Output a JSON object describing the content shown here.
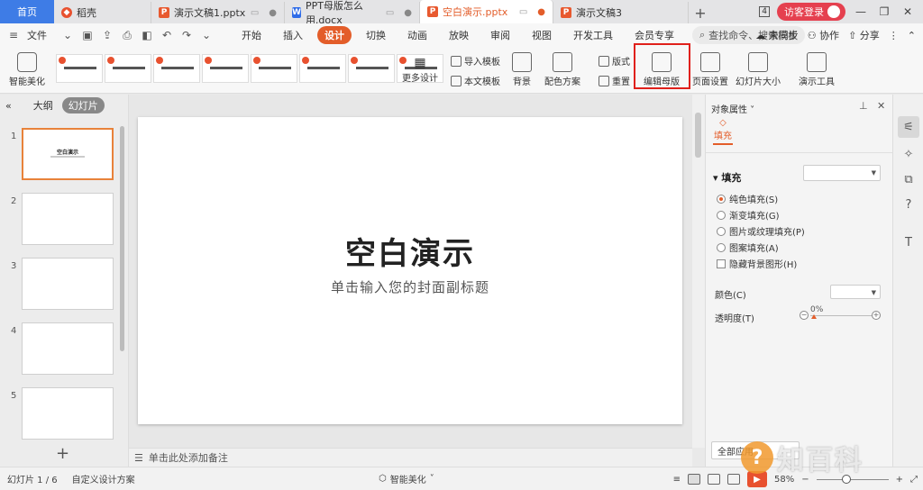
{
  "tabs": {
    "home": "首页",
    "items": [
      {
        "label": "稻壳",
        "icon": "daoke-icon"
      },
      {
        "label": "演示文稿1.pptx",
        "icon": "ppt-icon"
      },
      {
        "label": "PPT母版怎么用.docx",
        "icon": "word-icon"
      },
      {
        "label": "空白演示.pptx",
        "icon": "ppt-icon",
        "active": true
      },
      {
        "label": "演示文稿3",
        "icon": "ppt-icon"
      }
    ],
    "badge": "4",
    "visitor_login": "访客登录"
  },
  "menubar": {
    "file": "文件",
    "items": [
      "开始",
      "插入",
      "设计",
      "切换",
      "动画",
      "放映",
      "审阅",
      "视图",
      "开发工具",
      "会员专享"
    ],
    "active": "设计",
    "search": "查找命令、搜索模板",
    "sync": "未同步",
    "collab": "协作",
    "share": "分享"
  },
  "ribbon": {
    "smart_beautify": "智能美化",
    "more_design": "更多设计",
    "import_template": "导入模板",
    "text_template": "本文模板",
    "background": "背景",
    "color_scheme": "配色方案",
    "layout": "版式",
    "reset": "重置",
    "edit_master": "编辑母版",
    "page_setup": "页面设置",
    "slide_size": "幻灯片大小",
    "present_tools": "演示工具"
  },
  "left_panel": {
    "outline": "大纲",
    "slides": "幻灯片",
    "thumbs": [
      {
        "num": "1",
        "title": "空白演示"
      },
      {
        "num": "2"
      },
      {
        "num": "3"
      },
      {
        "num": "4"
      },
      {
        "num": "5"
      }
    ]
  },
  "slide": {
    "title": "空白演示",
    "subtitle": "单击输入您的封面副标题"
  },
  "notes": "单击此处添加备注",
  "right_panel": {
    "title": "对象属性",
    "fill_tab": "填充",
    "section": "填充",
    "options": [
      {
        "label": "纯色填充(S)",
        "type": "radio",
        "checked": true
      },
      {
        "label": "渐变填充(G)",
        "type": "radio"
      },
      {
        "label": "图片或纹理填充(P)",
        "type": "radio"
      },
      {
        "label": "图案填充(A)",
        "type": "radio"
      },
      {
        "label": "隐藏背景图形(H)",
        "type": "checkbox"
      }
    ],
    "color_label": "颜色(C)",
    "transparency_label": "透明度(T)",
    "transparency_value": "0%",
    "apply_all": "全部应用"
  },
  "statusbar": {
    "slide_info": "幻灯片 1 / 6",
    "design_scheme": "自定义设计方案",
    "smart_beautify": "智能美化",
    "zoom": "58%"
  },
  "watermark": {
    "logo": "?",
    "text": "知百科"
  },
  "colors": {
    "accent": "#e35d2a",
    "home_tab": "#3e7ce6",
    "highlight_box": "#e0201b"
  }
}
